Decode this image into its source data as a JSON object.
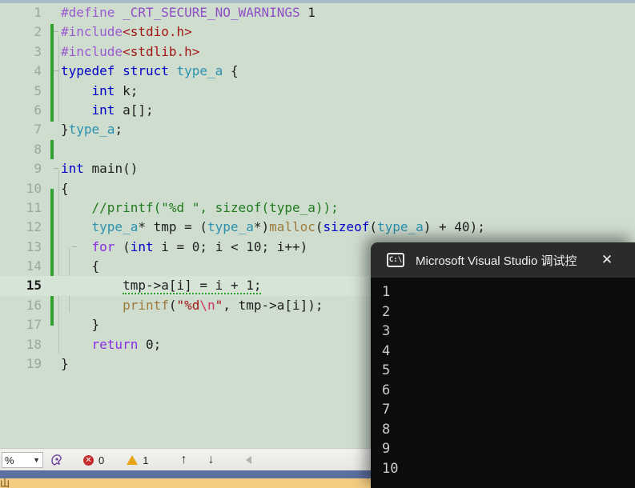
{
  "editor": {
    "language": "c",
    "background_color": "#cfddcf",
    "current_line": 15,
    "lines": [
      {
        "n": "1",
        "outline": "",
        "text": "#define _CRT_SECURE_NO_WARNINGS 1"
      },
      {
        "n": "2",
        "outline": "−",
        "text": "#include<stdio.h>"
      },
      {
        "n": "3",
        "outline": "",
        "text": "#include<stdlib.h>"
      },
      {
        "n": "4",
        "outline": "−",
        "text": "typedef struct type_a {"
      },
      {
        "n": "5",
        "outline": "",
        "text": "    int k;"
      },
      {
        "n": "6",
        "outline": "",
        "text": "    int a[];"
      },
      {
        "n": "7",
        "outline": "",
        "text": "}type_a;"
      },
      {
        "n": "8",
        "outline": "",
        "text": ""
      },
      {
        "n": "9",
        "outline": "−",
        "text": "int main()"
      },
      {
        "n": "10",
        "outline": "",
        "text": "{"
      },
      {
        "n": "11",
        "outline": "",
        "text": "    //printf(\"%d \", sizeof(type_a));"
      },
      {
        "n": "12",
        "outline": "",
        "text": "    type_a* tmp = (type_a*)malloc(sizeof(type_a) + 40);"
      },
      {
        "n": "13",
        "outline": "−",
        "text": "    for (int i = 0; i < 10; i++)"
      },
      {
        "n": "14",
        "outline": "",
        "text": "    {"
      },
      {
        "n": "15",
        "outline": "",
        "text": "        tmp->a[i] = i + 1;"
      },
      {
        "n": "16",
        "outline": "",
        "text": "        printf(\"%d\\n\", tmp->a[i]);"
      },
      {
        "n": "17",
        "outline": "",
        "text": "    }"
      },
      {
        "n": "18",
        "outline": "",
        "text": "    return 0;"
      },
      {
        "n": "19",
        "outline": "",
        "text": "}"
      }
    ]
  },
  "statusbar": {
    "zoom_value": "%",
    "dropdown_caret": "▼",
    "spell_icon": "spell-check-icon",
    "error_icon_glyph": "✕",
    "error_count": "0",
    "warning_count": "1",
    "prev_arrow": "↑",
    "next_arrow": "↓",
    "collapse_arrow": "◀"
  },
  "bottom_bar": {
    "text": "山"
  },
  "console": {
    "icon_label": "C:\\",
    "title": "Microsoft Visual Studio 调试控",
    "close_label": "✕",
    "output": [
      "1",
      "2",
      "3",
      "4",
      "5",
      "6",
      "7",
      "8",
      "9",
      "10"
    ]
  }
}
